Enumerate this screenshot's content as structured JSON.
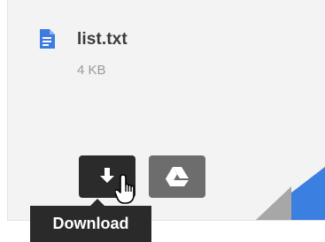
{
  "file": {
    "name": "list.txt",
    "size": "4 KB",
    "icon": "document-icon"
  },
  "actions": {
    "download_icon": "download-arrow-icon",
    "drive_icon": "google-drive-icon"
  },
  "tooltip": {
    "label": "Download"
  },
  "colors": {
    "file_icon": "#3d7be0",
    "download_button": "#2b2b2b",
    "drive_button": "#6d6d6d",
    "tooltip_bg": "#2a2a2a",
    "corner_blue": "#3b7fe0",
    "corner_gray": "#a7a7a7"
  }
}
